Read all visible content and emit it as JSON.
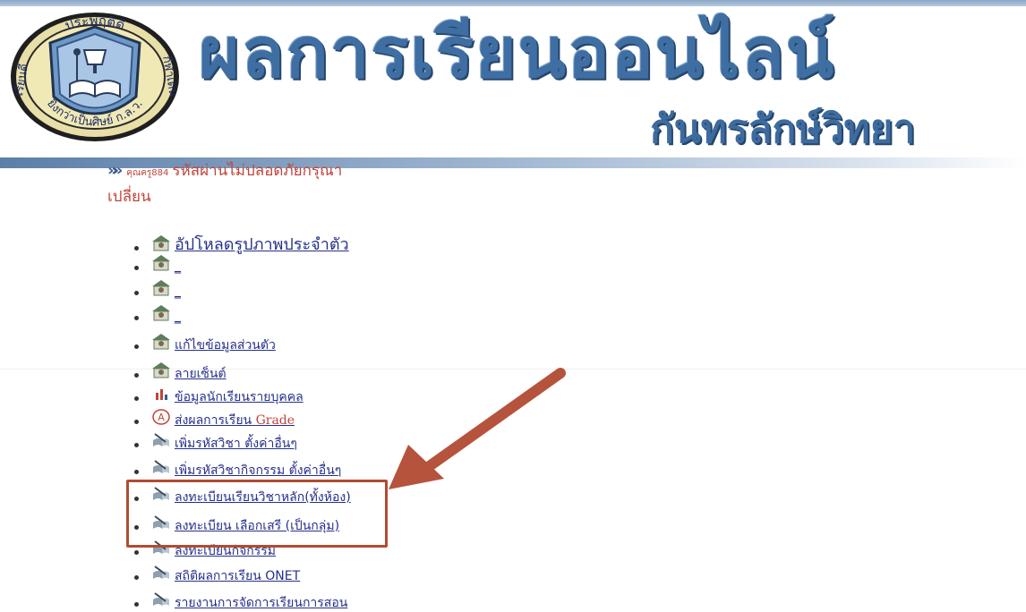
{
  "header": {
    "title": "ผลการเรียนออนไลน์",
    "subtitle": "กันทรลักษ์วิทยา",
    "logo": {
      "top_text": "ประพฤติดี",
      "left_text": "เรียนดี",
      "right_text": "กีฬาเด่น",
      "bottom_text": "ยิ่งกว่าเป็นศิษย์ ก.ล.ว."
    }
  },
  "notice": {
    "user_label": "คุณครู884",
    "message_line1": "รหัสผ่านไม่ปลอดภัยกรุณา",
    "message_line2": "เปลี่ยน"
  },
  "menu": [
    {
      "label": "อัปโหลดรูปภาพประจำตัว",
      "icon": "user-photo-icon"
    },
    {
      "label": "_",
      "icon": "user-photo-icon"
    },
    {
      "label": "_",
      "icon": "user-photo-icon"
    },
    {
      "label": "_",
      "icon": "user-photo-icon"
    },
    {
      "label": "แก้ไขข้อมูลส่วนตัว",
      "icon": "user-photo-icon"
    },
    {
      "label": "ลายเซ็นต์",
      "icon": "user-photo-icon"
    },
    {
      "label": "ข้อมูลนักเรียนรายบุคคล",
      "icon": "bar-chart-icon"
    },
    {
      "label": "ส่งผลการเรียน",
      "label_suffix": "Grade",
      "icon": "grade-a-icon"
    },
    {
      "label": "เพิ่มรหัสวิชา ตั้งค่าอื่นๆ",
      "icon": "book-pen-icon"
    },
    {
      "label": "เพิ่มรหัสวิชากิจกรรม ตั้งค่าอื่นๆ",
      "icon": "book-pen-icon"
    },
    {
      "label": "ลงทะเบียนเรียนวิชาหลัก(ทั้งห้อง)",
      "icon": "book-pen-icon"
    },
    {
      "label": "ลงทะเบียน เลือกเสรี (เป็นกลุ่ม)",
      "icon": "book-pen-icon"
    },
    {
      "label": "ลงทะเบียนกิจกรรม",
      "icon": "book-pen-icon"
    },
    {
      "label": "สถิติผลการเรียน ONET",
      "icon": "book-pen-icon"
    },
    {
      "label": "รายงานการจัดการเรียนการสอน",
      "icon": "book-pen-icon"
    }
  ],
  "colors": {
    "title_blue": "#3f6ea3",
    "link_blue": "#26308a",
    "notice_red": "#c0443a",
    "highlight_box": "#b04c33",
    "arrow": "#b5533c"
  }
}
